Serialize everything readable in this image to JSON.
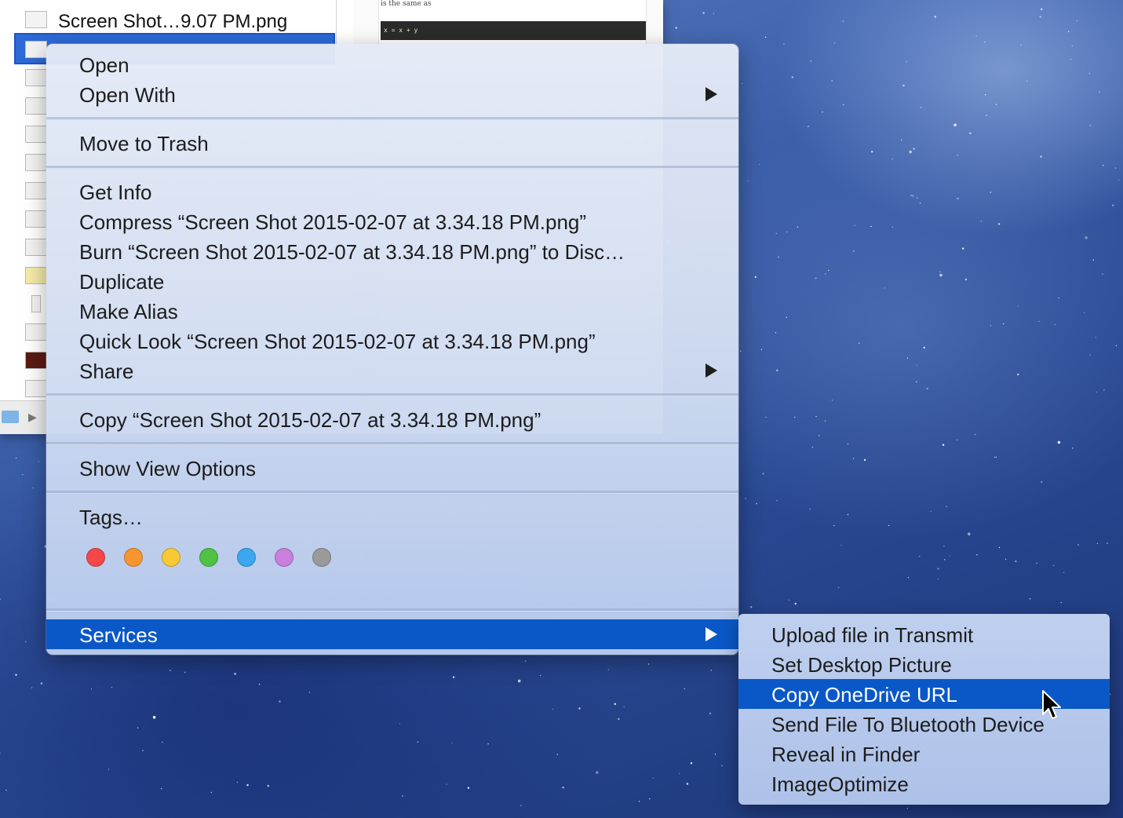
{
  "finder": {
    "files": [
      {
        "name": "Screen Shot…9.07 PM.png",
        "selected": false
      },
      {
        "name": "",
        "selected": true
      },
      {
        "name": "",
        "selected": false
      },
      {
        "name": "",
        "selected": false
      },
      {
        "name": "",
        "selected": false
      },
      {
        "name": "",
        "selected": false
      },
      {
        "name": "",
        "selected": false
      },
      {
        "name": "",
        "selected": false
      },
      {
        "name": "",
        "selected": false
      },
      {
        "name": "",
        "selected": false
      },
      {
        "name": "",
        "selected": false
      },
      {
        "name": "",
        "selected": false
      },
      {
        "name": "",
        "selected": false
      },
      {
        "name": "",
        "selected": false
      }
    ],
    "preview": {
      "text": "is the same as",
      "code": "x = x + y"
    }
  },
  "context_menu": {
    "open": "Open",
    "open_with": "Open With",
    "move_to_trash": "Move to Trash",
    "get_info": "Get Info",
    "compress": "Compress “Screen Shot 2015-02-07 at 3.34.18 PM.png”",
    "burn": "Burn “Screen Shot 2015-02-07 at 3.34.18 PM.png” to Disc…",
    "duplicate": "Duplicate",
    "make_alias": "Make Alias",
    "quick_look": "Quick Look “Screen Shot 2015-02-07 at 3.34.18 PM.png”",
    "share": "Share",
    "copy": "Copy “Screen Shot 2015-02-07 at 3.34.18 PM.png”",
    "show_view_options": "Show View Options",
    "tags": "Tags…",
    "tag_colors": [
      {
        "name": "red",
        "color": "#f4474a"
      },
      {
        "name": "orange",
        "color": "#f7962f"
      },
      {
        "name": "yellow",
        "color": "#f7c934"
      },
      {
        "name": "green",
        "color": "#4fc244"
      },
      {
        "name": "blue",
        "color": "#3aa7f0"
      },
      {
        "name": "purple",
        "color": "#c97fdc"
      },
      {
        "name": "gray",
        "color": "#9a9a9a"
      }
    ],
    "services": "Services",
    "highlight_color": "#0a58c8"
  },
  "services_submenu": {
    "items": [
      {
        "label": "Upload file in Transmit",
        "highlighted": false
      },
      {
        "label": "Set Desktop Picture",
        "highlighted": false
      },
      {
        "label": "Copy OneDrive URL",
        "highlighted": true
      },
      {
        "label": "Send File To Bluetooth Device",
        "highlighted": false
      },
      {
        "label": "Reveal in Finder",
        "highlighted": false
      },
      {
        "label": "ImageOptimize",
        "highlighted": false
      }
    ]
  }
}
